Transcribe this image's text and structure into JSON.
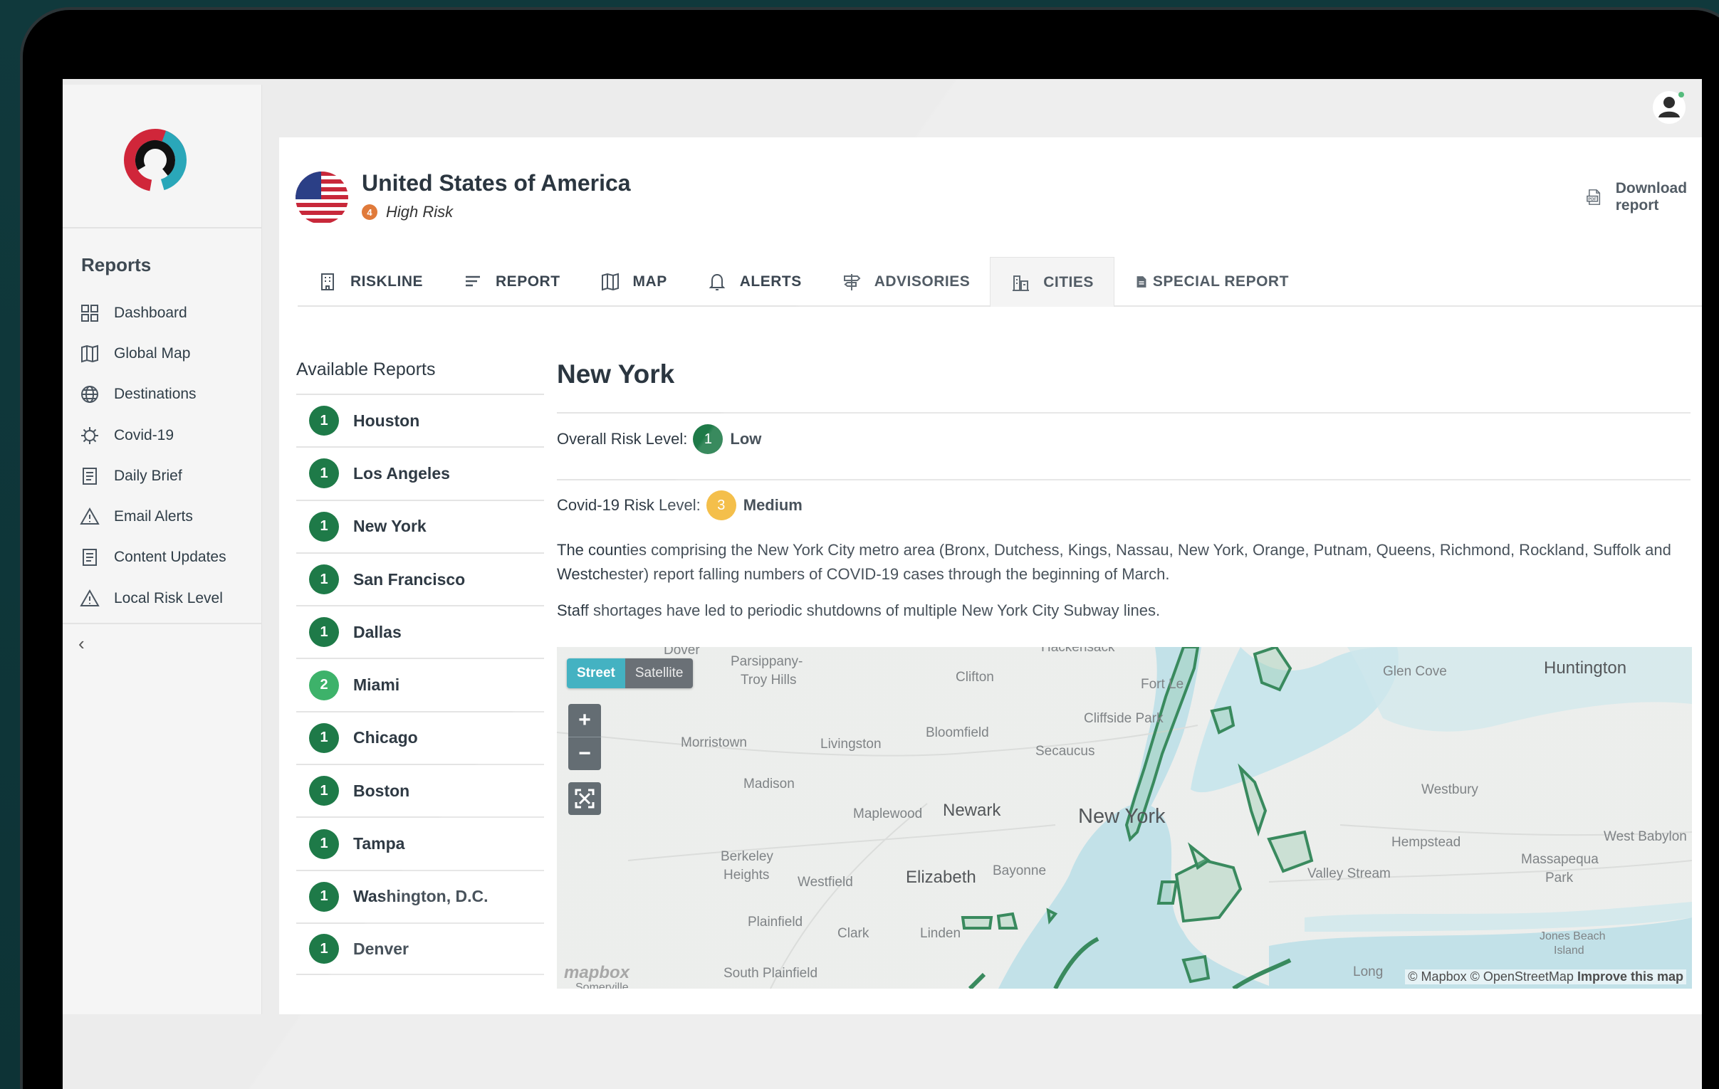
{
  "sidebar": {
    "heading": "Reports",
    "items": [
      {
        "label": "Dashboard",
        "icon": "grid-icon"
      },
      {
        "label": "Global Map",
        "icon": "map-icon"
      },
      {
        "label": "Destinations",
        "icon": "globe-icon"
      },
      {
        "label": "Covid-19",
        "icon": "virus-icon"
      },
      {
        "label": "Daily Brief",
        "icon": "document-icon"
      },
      {
        "label": "Email Alerts",
        "icon": "warning-icon"
      },
      {
        "label": "Content Updates",
        "icon": "document-icon"
      },
      {
        "label": "Local Risk Level",
        "icon": "warning-icon"
      }
    ],
    "collapse_glyph": "‹"
  },
  "header": {
    "country": "United States of America",
    "risk_level_number": "4",
    "risk_label": "High Risk",
    "download_label": "Download report"
  },
  "tabs": [
    {
      "label": "RISKLINE",
      "icon": "building-icon"
    },
    {
      "label": "REPORT",
      "icon": "lines-icon"
    },
    {
      "label": "MAP",
      "icon": "map-icon"
    },
    {
      "label": "ALERTS",
      "icon": "bell-icon"
    },
    {
      "label": "ADVISORIES",
      "icon": "signpost-icon"
    },
    {
      "label": "CITIES",
      "icon": "city-icon",
      "active": true
    },
    {
      "label": "SPECIAL REPORT",
      "icon": "file-icon"
    }
  ],
  "reports": {
    "title": "Available Reports",
    "cities": [
      {
        "level": "1",
        "name": "Houston"
      },
      {
        "level": "1",
        "name": "Los Angeles"
      },
      {
        "level": "1",
        "name": "New York"
      },
      {
        "level": "1",
        "name": "San Francisco"
      },
      {
        "level": "1",
        "name": "Dallas"
      },
      {
        "level": "2",
        "name": "Miami"
      },
      {
        "level": "1",
        "name": "Chicago"
      },
      {
        "level": "1",
        "name": "Boston"
      },
      {
        "level": "1",
        "name": "Tampa"
      },
      {
        "level": "1",
        "name": "Washington, D.C."
      },
      {
        "level": "1",
        "name": "Denver"
      }
    ]
  },
  "detail": {
    "city": "New York",
    "overall_label": "Overall Risk Level:",
    "overall_level": "1",
    "overall_value": "Low",
    "covid_label": "Covid-19 Risk Level:",
    "covid_level": "3",
    "covid_value": "Medium",
    "paragraph1": "The counties comprising the New York City metro area (Bronx, Dutchess, Kings, Nassau, New York, Orange, Putnam, Queens, Richmond, Rockland, Suffolk and Westchester) report falling numbers of COVID-19 cases through the beginning of March.",
    "paragraph2": "Staff shortages have led to periodic shutdowns of multiple New York City Subway lines."
  },
  "map": {
    "street_label": "Street",
    "satellite_label": "Satellite",
    "zoom_in": "+",
    "zoom_out": "−",
    "labels": {
      "dover": "Dover",
      "hackensack": "Hackensack",
      "parsippany": "Parsippany-",
      "troy_hills": "Troy Hills",
      "clifton": "Clifton",
      "fort_lee": "Fort Le",
      "glen_cove": "Glen Cove",
      "huntington": "Huntington",
      "cliffside": "Cliffside Park",
      "bloomfield": "Bloomfield",
      "secaucus": "Secaucus",
      "morristown": "Morristown",
      "livingston": "Livingston",
      "madison": "Madison",
      "maplewood": "Maplewood",
      "newark": "Newark",
      "new_york": "New York",
      "westbury": "Westbury",
      "hempstead": "Hempstead",
      "west_babylon": "West Babylon",
      "berkeley": "Berkeley",
      "heights": "Heights",
      "westfield": "Westfield",
      "elizabeth": "Elizabeth",
      "bayonne": "Bayonne",
      "valley_stream": "Valley Stream",
      "massapequa": "Massapequa",
      "park": "Park",
      "plainfield": "Plainfield",
      "clark": "Clark",
      "linden": "Linden",
      "jones_beach": "Jones Beach",
      "island": "Island",
      "south_plainfield": "South Plainfield",
      "somerville": "Somerville",
      "long": "Long"
    },
    "attribution_plain": "© Mapbox © OpenStreetMap",
    "attribution_link": "Improve this map",
    "logo_text": "mapbox"
  },
  "colors": {
    "accent_teal": "#2aa7b9",
    "risk_green": "#1e7a48",
    "risk_light_green": "#3db26a",
    "risk_yellow": "#f2b632",
    "risk_orange": "#e07a3a",
    "brand_red": "#d0263a"
  }
}
